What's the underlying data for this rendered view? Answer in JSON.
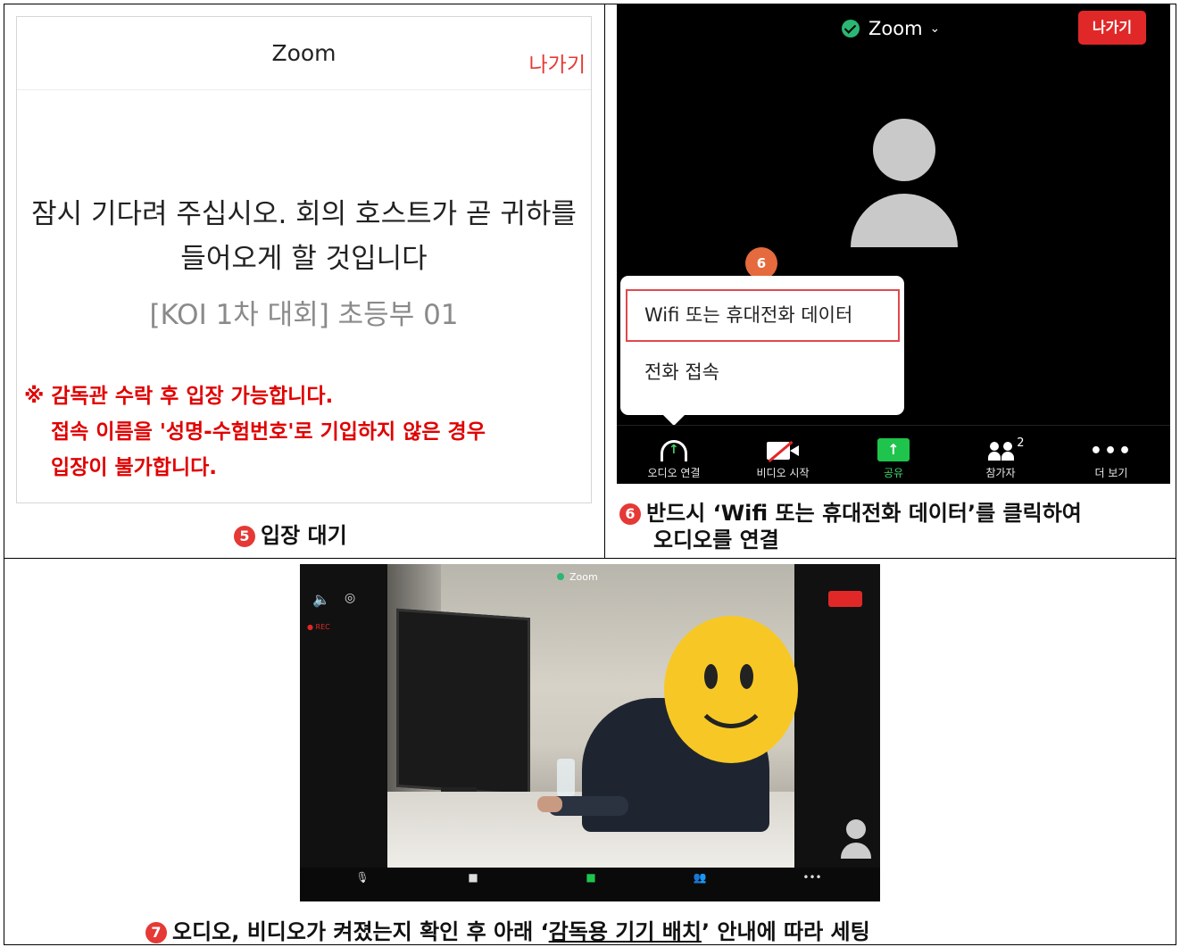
{
  "panel5": {
    "app_title": "Zoom",
    "leave_label": "나가기",
    "wait_message_line1": "잠시 기다려 주십시오. 회의 호스트가 곧 귀하를",
    "wait_message_line2": "들어오게 할 것입니다",
    "meeting_name": "[KOI 1차 대회] 초등부 01",
    "notice_line1": "※ 감독관 수락 후 입장 가능합니다.",
    "notice_line2": "접속 이름을 '성명-수험번호'로 기입하지 않은 경우",
    "notice_line3": "입장이 불가합니다.",
    "caption_number": "5",
    "caption_text": "입장 대기"
  },
  "panel6": {
    "app_title": "Zoom",
    "leave_label": "나가기",
    "step_badge": "6",
    "audio_options": [
      "Wifi 또는 휴대전화 데이터",
      "전화 접속"
    ],
    "toolbar": [
      {
        "label": "오디오 연결",
        "icon": "headphone-icon"
      },
      {
        "label": "비디오 시작",
        "icon": "video-off-icon"
      },
      {
        "label": "공유",
        "icon": "share-icon"
      },
      {
        "label": "참가자",
        "icon": "people-icon",
        "count": "2"
      },
      {
        "label": "더 보기",
        "icon": "more-icon"
      }
    ],
    "caption_number": "6",
    "caption_line1": "반드시 ‘Wifi 또는 휴대전화 데이터’를 클릭하여",
    "caption_line2": "오디오를 연결"
  },
  "panel7": {
    "app_title": "Zoom",
    "caption_number": "7",
    "caption_before": "오디오, 비디오가 켜졌는지 확인 후 아래 ‘",
    "caption_underlined": "감독용 기기 배치",
    "caption_after": "’ 안내에 따라 세팅"
  },
  "colors": {
    "accent_red": "#e53935",
    "zoom_green": "#2bb673",
    "leave_button": "#e02828"
  }
}
